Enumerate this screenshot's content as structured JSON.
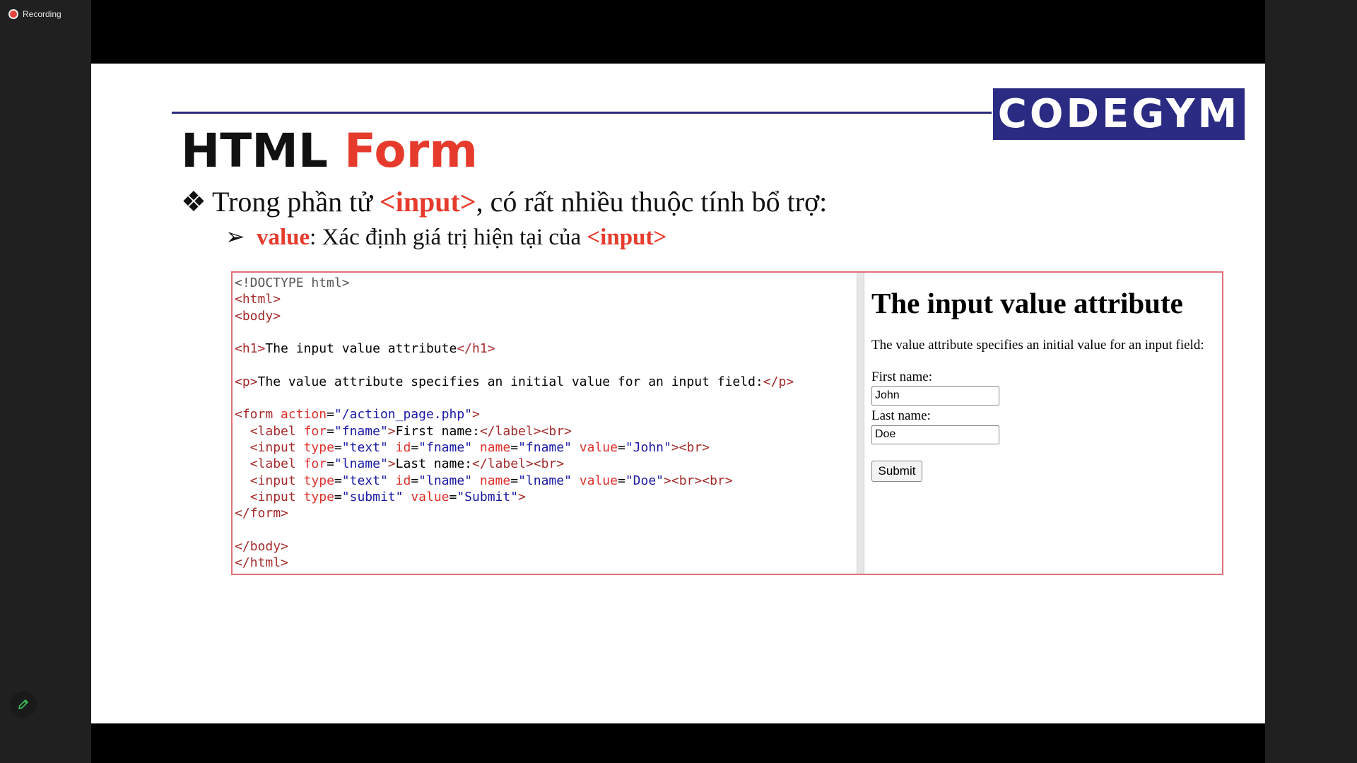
{
  "recording": {
    "label": "Recording"
  },
  "slide": {
    "logo_text": "CODEGYM",
    "title_black": "HTML ",
    "title_red": "Form",
    "bullet1": {
      "glyph": "❖",
      "pre": "Trong phần tử ",
      "tag": "<input>",
      "post": ", có rất nhiều thuộc tính bổ trợ:"
    },
    "bullet2": {
      "glyph": "➢",
      "keyword": "value",
      "pre": ": Xác định giá trị hiện tại của ",
      "tag": "<input>"
    }
  },
  "code": {
    "l1": "<!DOCTYPE html>",
    "l2": "html",
    "l3": "body",
    "l5_open": "h1",
    "l5_text": "The input value attribute",
    "l7_open": "p",
    "l7_text": "The value attribute specifies an initial value for an input field:",
    "form": "form",
    "action": "action",
    "action_val": "\"/action_page.php\"",
    "label": "label",
    "for": "for",
    "fname_val": "\"fname\"",
    "lname_val": "\"lname\"",
    "first_label": "First name:",
    "last_label": "Last name:",
    "br": "br",
    "input": "input",
    "type": "type",
    "text_val": "\"text\"",
    "id": "id",
    "name": "name",
    "value": "value",
    "john_val": "\"John\"",
    "doe_val": "\"Doe\"",
    "submit_type": "\"submit\"",
    "submit_val": "\"Submit\""
  },
  "result": {
    "heading": "The input value attribute",
    "paragraph": "The value attribute specifies an initial value for an input field:",
    "first_label": "First name:",
    "first_value": "John",
    "last_label": "Last name:",
    "last_value": "Doe",
    "submit": "Submit"
  }
}
